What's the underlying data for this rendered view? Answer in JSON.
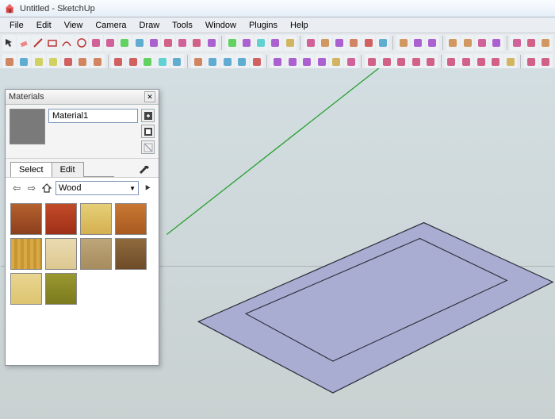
{
  "title": "Untitled - SketchUp",
  "menus": [
    "File",
    "Edit",
    "View",
    "Camera",
    "Draw",
    "Tools",
    "Window",
    "Plugins",
    "Help"
  ],
  "toolbar_row1": [
    "select",
    "eraser",
    "line",
    "rectangle",
    "arc",
    "circle",
    "paint",
    "panel",
    "component",
    "pushpull",
    "move",
    "rotate",
    "scale",
    "offset",
    "tape",
    "sep",
    "dimension",
    "text",
    "protractor",
    "axes",
    "section",
    "sep",
    "orbit",
    "pan",
    "zoom",
    "zoom-extents",
    "zoom-window",
    "previous",
    "sep",
    "position-camera",
    "walk",
    "look",
    "sep",
    "iso",
    "top",
    "front",
    "side",
    "sep",
    "arrow",
    "paint2",
    "box"
  ],
  "toolbar_row2": [
    "sandbox-grid",
    "sandbox-smoove",
    "sandbox-stamp",
    "sandbox-drape",
    "sandbox-add",
    "sandbox-flip",
    "sandbox-mesh",
    "sep",
    "plugin-blue",
    "plugin-cyan",
    "plugin-sq",
    "plugin-box",
    "plugin-r",
    "sep",
    "plugin-arrow",
    "plugin-c",
    "plugin-o",
    "plugin-k",
    "plugin-play",
    "sep",
    "cyl1",
    "cyl2",
    "cyl3",
    "cone",
    "cyl-add",
    "cyl-y",
    "sep",
    "ball-o",
    "ball-w",
    "ball-y",
    "ball-t",
    "ball-g",
    "sep",
    "circ-y",
    "circ-g",
    "circ-r",
    "circ-b",
    "circ-or",
    "sep",
    "shape1",
    "shape2"
  ],
  "materials": {
    "panel_title": "Materials",
    "current_name": "Material1",
    "tabs": {
      "select": "Select",
      "edit": "Edit"
    },
    "library": "Wood",
    "swatches": [
      {
        "name": "wood-cherry",
        "bg": "linear-gradient(#b5612f,#8c3f1c)"
      },
      {
        "name": "wood-red",
        "bg": "linear-gradient(#c24b28,#9e2f18)"
      },
      {
        "name": "wood-pine",
        "bg": "linear-gradient(#e6cf78,#d4b050)"
      },
      {
        "name": "wood-oak",
        "bg": "linear-gradient(#c87833,#a85a20)"
      },
      {
        "name": "wood-bamboo",
        "bg": "repeating-linear-gradient(90deg,#d9a948 0 4px,#c79630 4px 8px)"
      },
      {
        "name": "wood-maple",
        "bg": "linear-gradient(#eadbb0,#dcc890)"
      },
      {
        "name": "wood-ash",
        "bg": "linear-gradient(#bda67a,#a68c5e)"
      },
      {
        "name": "wood-walnut",
        "bg": "linear-gradient(#8f6a3e,#6e4c28)"
      },
      {
        "name": "wood-birch",
        "bg": "linear-gradient(#e8d590,#dcc470)"
      },
      {
        "name": "wood-olive",
        "bg": "linear-gradient(#9a9830,#7b7a1e)"
      }
    ]
  }
}
